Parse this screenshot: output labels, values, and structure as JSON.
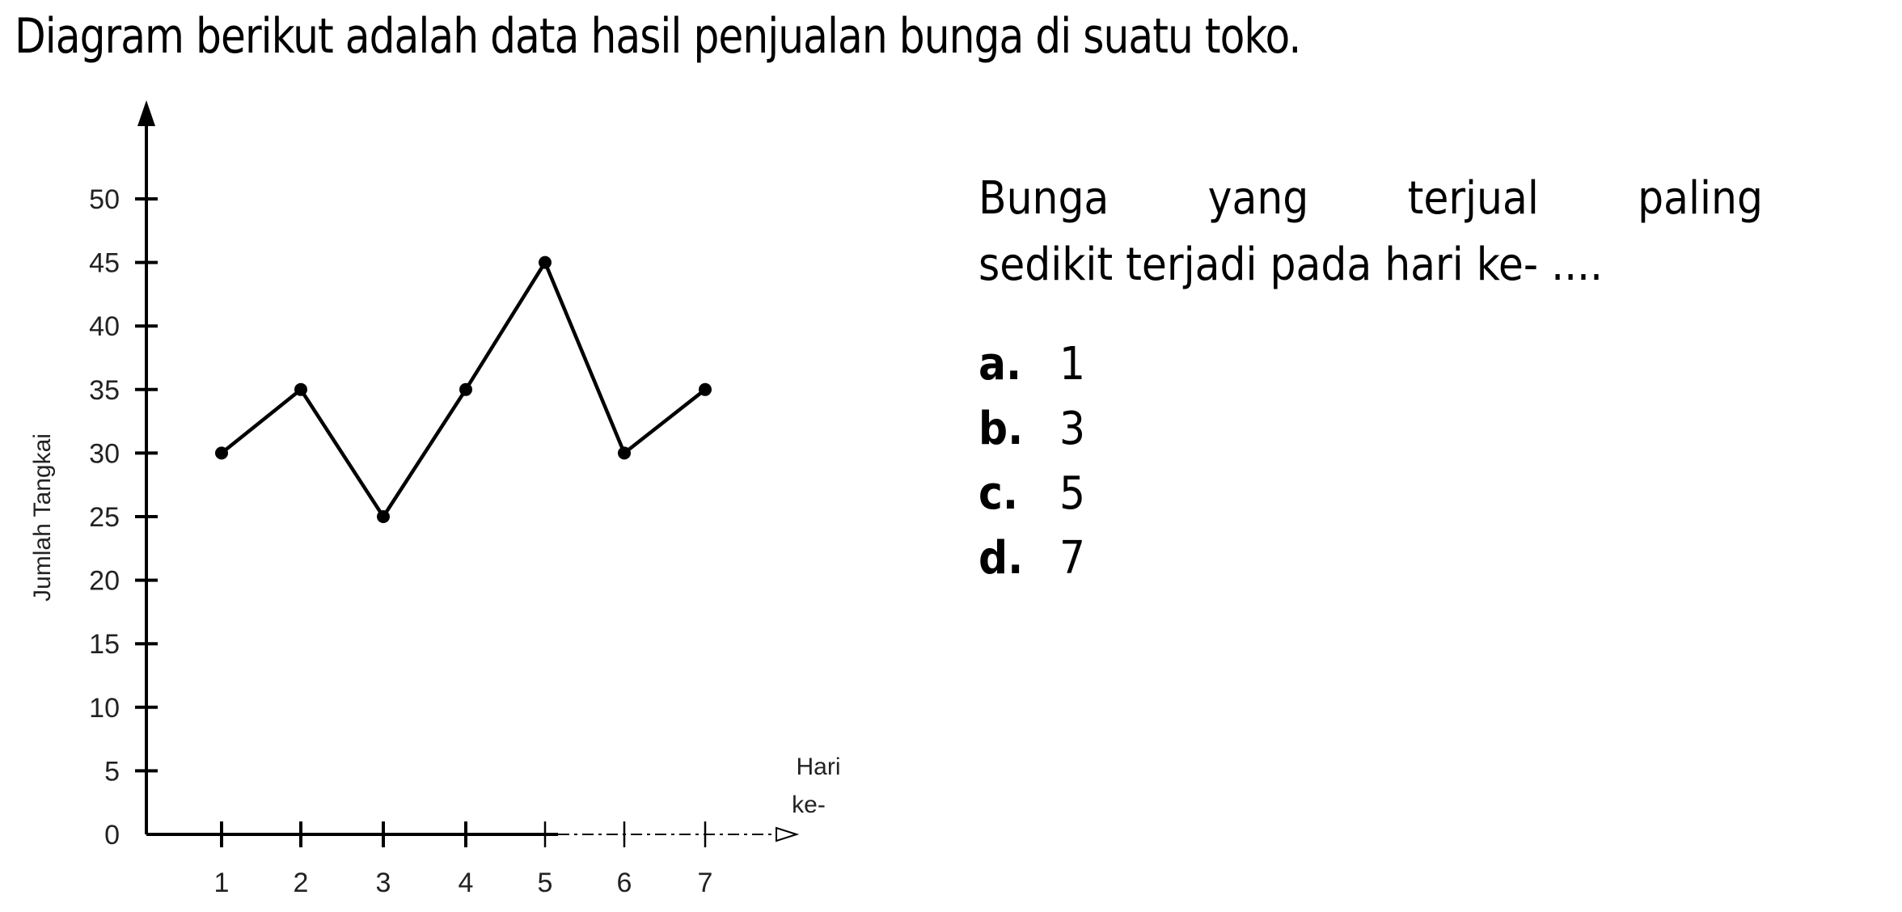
{
  "title": "Diagram berikut adalah data hasil penjualan bunga di suatu toko.",
  "question": {
    "line1_words": [
      "Bunga",
      "yang",
      "terjual",
      "paling"
    ],
    "line2": "sedikit terjadi pada hari ke- ...."
  },
  "options": [
    {
      "letter": "a.",
      "value": "1"
    },
    {
      "letter": "b.",
      "value": "3"
    },
    {
      "letter": "c.",
      "value": "5"
    },
    {
      "letter": "d.",
      "value": "7"
    }
  ],
  "chart_data": {
    "type": "line",
    "title": "",
    "xlabel": "Hari ke-",
    "xlabel_lines": [
      "Hari",
      "ke-"
    ],
    "ylabel": "Jumlah Tangkai",
    "x": [
      1,
      2,
      3,
      4,
      5,
      6,
      7
    ],
    "categories": [
      "1",
      "2",
      "3",
      "4",
      "5",
      "6",
      "7"
    ],
    "values": [
      30,
      35,
      25,
      35,
      45,
      30,
      35
    ],
    "yticks": [
      0,
      5,
      10,
      15,
      20,
      25,
      30,
      35,
      40,
      45,
      50
    ],
    "ylim": [
      0,
      50
    ],
    "grid": false,
    "legend": "none",
    "color": "#000000"
  }
}
